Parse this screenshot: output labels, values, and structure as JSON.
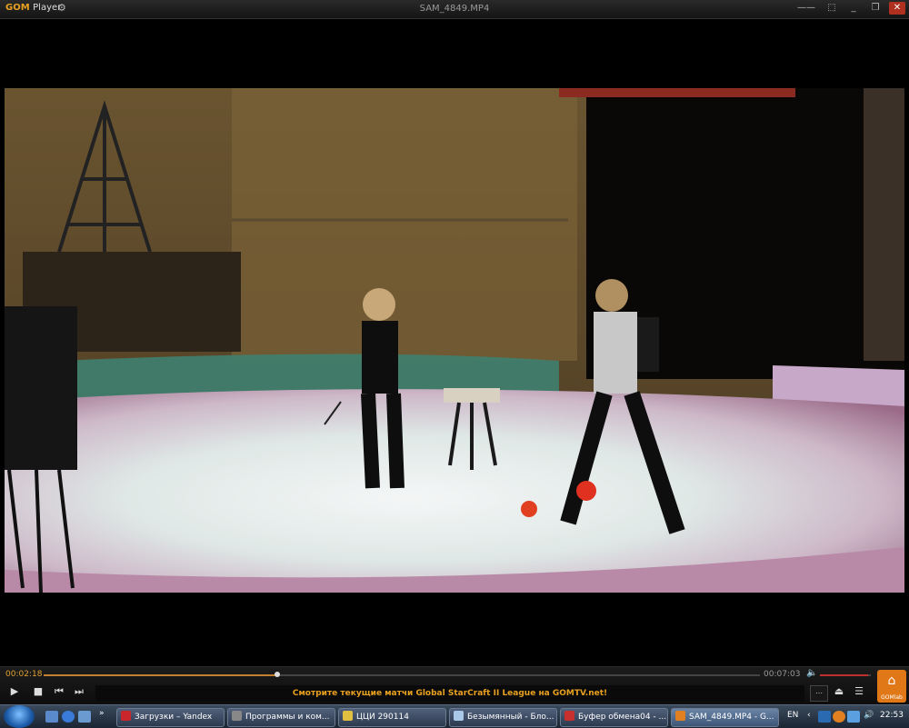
{
  "app": {
    "logo": "GOM",
    "logo_suffix": "Player",
    "window_title": "SAM_4849.MP4"
  },
  "player": {
    "current_time": "00:02:18",
    "total_time": "00:07:03",
    "progress": 0.326,
    "volume": 0.95,
    "ticker": "Смотрите текущие матчи Global StarCraft II League на GOMTV.net!",
    "gomlab_label": "GOMlab"
  },
  "icons": {
    "settings": "gear-icon",
    "play": "play-icon",
    "stop": "stop-icon",
    "prev": "prev-icon",
    "next": "next-icon",
    "volume": "speaker-icon",
    "eject": "eject-icon",
    "menu": "menu-icon",
    "home": "home-icon"
  },
  "colors": {
    "accent": "#e8a020",
    "gomlab": "#e07818"
  },
  "taskbar": {
    "items": [
      {
        "label": "Загрузки – Yandex",
        "color": "#c8262a"
      },
      {
        "label": "Программы и ком...",
        "color": "#888888"
      },
      {
        "label": "ЦЦИ 290114",
        "color": "#e0c040"
      },
      {
        "label": "Безымянный - Бло...",
        "color": "#aac8e8"
      },
      {
        "label": "Буфер обмена04 - ...",
        "color": "#c83030"
      },
      {
        "label": "SAM_4849.MP4 - G...",
        "color": "#e08020"
      }
    ],
    "language": "EN",
    "clock": "22:53"
  }
}
